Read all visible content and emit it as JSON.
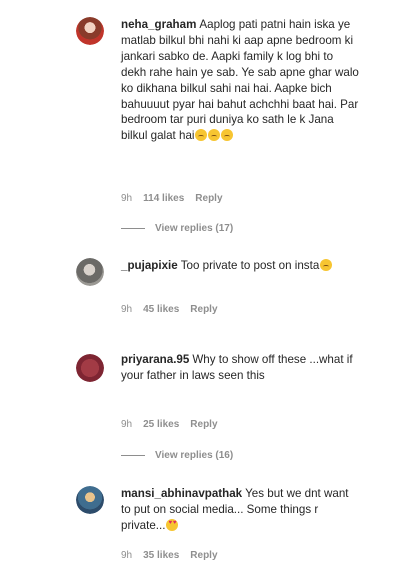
{
  "comments": [
    {
      "username": "neha_graham",
      "text": "Aaplog pati patni hain iska ye matlab bilkul bhi nahi ki aap apne bedroom ki jankari sabko de. Aapki family k log bhi to dekh rahe hain ye sab. Ye sab apne ghar walo ko dikhana bilkul sahi nai hai. Aapke bich bahuuuut pyar hai bahut achchhi baat hai. Par bedroom tar puri duniya ko sath le k Jana bilkul galat hai",
      "time": "9h",
      "likes": "114 likes",
      "reply": "Reply",
      "view_replies": "View replies (17)"
    },
    {
      "username": "_pujapixie",
      "text": "Too private to post on insta",
      "time": "9h",
      "likes": "45 likes",
      "reply": "Reply"
    },
    {
      "username": "priyarana.95",
      "text": "Why to show off these ...what if your father in laws seen this",
      "time": "9h",
      "likes": "25 likes",
      "reply": "Reply",
      "view_replies": "View replies (16)"
    },
    {
      "username": "mansi_abhinavpathak",
      "text": "Yes but we dnt want to put on social media... Some things r private...",
      "time": "9h",
      "likes": "35 likes",
      "reply": "Reply"
    }
  ]
}
